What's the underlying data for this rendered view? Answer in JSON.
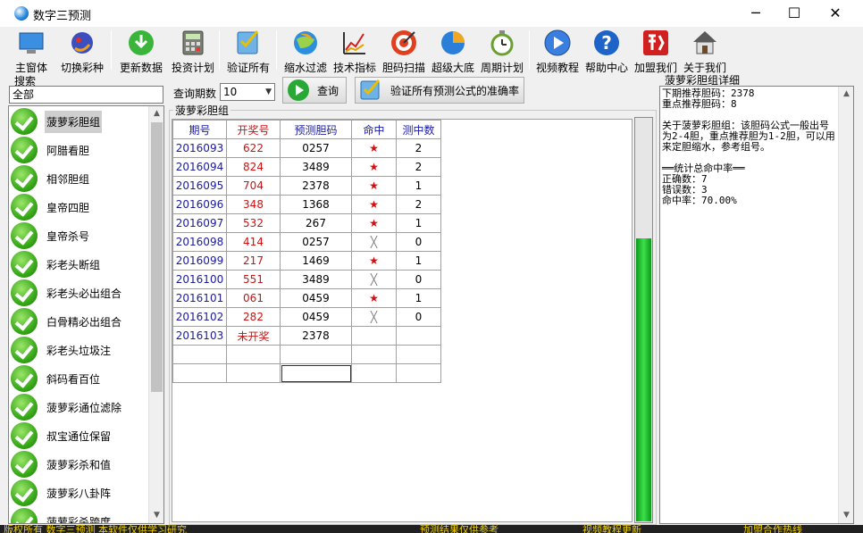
{
  "window": {
    "title": "数字三预测"
  },
  "toolbar": [
    {
      "label": "主窗体",
      "icon": "monitor-icon"
    },
    {
      "label": "切换彩种",
      "icon": "dragon-icon"
    },
    {
      "label": "更新数据",
      "icon": "download-icon"
    },
    {
      "label": "投资计划",
      "icon": "calculator-icon"
    },
    {
      "label": "验证所有",
      "icon": "checklist-icon"
    },
    {
      "label": "缩水过滤",
      "icon": "globe-icon"
    },
    {
      "label": "技术指标",
      "icon": "chart-icon"
    },
    {
      "label": "胆码扫描",
      "icon": "target-icon"
    },
    {
      "label": "超级大底",
      "icon": "pie-icon"
    },
    {
      "label": "周期计划",
      "icon": "clock-icon"
    },
    {
      "label": "视频教程",
      "icon": "play-icon"
    },
    {
      "label": "帮助中心",
      "icon": "help-icon"
    },
    {
      "label": "加盟我们",
      "icon": "lottery-logo-icon"
    },
    {
      "label": "关于我们",
      "icon": "house-icon"
    }
  ],
  "search": {
    "label": "搜索",
    "value": "全部"
  },
  "left_list": {
    "selected_index": 0,
    "items": [
      "菠萝彩胆组",
      "阿腊看胆",
      "相邻胆组",
      "皇帝四胆",
      "皇帝杀号",
      "彩老头断组",
      "彩老头必出组合",
      "白骨精必出组合",
      "彩老头垃圾注",
      "斜码看百位",
      "菠萝彩通位滤除",
      "叔宝通位保留",
      "菠萝彩杀和值",
      "菠萝彩八卦阵",
      "菠萝彩杀跨度"
    ]
  },
  "query": {
    "period_label": "查询期数",
    "period_value": "10",
    "query_button": "查询",
    "verify_button": "验证所有预测公式的准确率"
  },
  "group": {
    "title": "菠萝彩胆组",
    "columns": [
      "期号",
      "开奖号",
      "预测胆码",
      "命中",
      "测中数"
    ],
    "rows": [
      {
        "id": "2016093",
        "draw": "622",
        "pred": "0257",
        "hit": true,
        "count": "2"
      },
      {
        "id": "2016094",
        "draw": "824",
        "pred": "3489",
        "hit": true,
        "count": "2"
      },
      {
        "id": "2016095",
        "draw": "704",
        "pred": "2378",
        "hit": true,
        "count": "1"
      },
      {
        "id": "2016096",
        "draw": "348",
        "pred": "1368",
        "hit": true,
        "count": "2"
      },
      {
        "id": "2016097",
        "draw": "532",
        "pred": "267",
        "hit": true,
        "count": "1"
      },
      {
        "id": "2016098",
        "draw": "414",
        "pred": "0257",
        "hit": false,
        "count": "0"
      },
      {
        "id": "2016099",
        "draw": "217",
        "pred": "1469",
        "hit": true,
        "count": "1"
      },
      {
        "id": "2016100",
        "draw": "551",
        "pred": "3489",
        "hit": false,
        "count": "0"
      },
      {
        "id": "2016101",
        "draw": "061",
        "pred": "0459",
        "hit": true,
        "count": "1"
      },
      {
        "id": "2016102",
        "draw": "282",
        "pred": "0459",
        "hit": false,
        "count": "0"
      },
      {
        "id": "2016103",
        "draw": "未开奖",
        "pred": "2378",
        "hit": null,
        "count": ""
      }
    ],
    "hit_symbol": "★",
    "miss_symbol": "╳"
  },
  "progress": {
    "value": 0.7
  },
  "detail": {
    "title": "菠萝彩胆组详细",
    "text": "下期推荐胆码：2378\n重点推荐胆码：8\n\n关于菠萝彩胆组：该胆码公式一般出号为2-4胆，重点推荐胆为1-2胆，可以用来定胆缩水，参考组号。\n\n══统计总命中率══\n正确数：7\n错误数：3\n命中率：70.00%"
  },
  "status": {
    "left": "版权所有 数字三预测 本软件仅供学习研究",
    "mid": "预测结果仅供参考",
    "right1": "视频教程更新",
    "right2": "加盟合作热线"
  },
  "colors": {
    "accent_green": "#2fc33a",
    "draw_red": "#d01010",
    "period_blue": "#1a1aa0"
  }
}
